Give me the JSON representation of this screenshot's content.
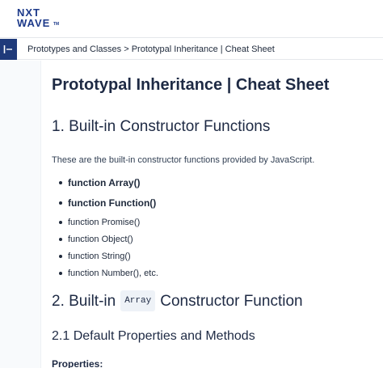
{
  "brand": {
    "line1": "NXT",
    "line2": "WAVE",
    "tm": "TM",
    "color": "#1d3a8a"
  },
  "sidebar_toggle": {
    "icon": "collapse-sidebar-icon",
    "color": "#1f3a7a"
  },
  "breadcrumb": "Prototypes and Classes > Prototypal Inheritance | Cheat Sheet",
  "page_title": "Prototypal Inheritance | Cheat Sheet",
  "section1": {
    "heading": "1. Built-in Constructor Functions",
    "intro": "These are the built-in constructor functions provided by JavaScript.",
    "items": [
      "function Array()",
      "function Function()",
      "function Promise()",
      "function Object()",
      "function String()",
      "function Number(), etc."
    ]
  },
  "section2": {
    "heading_prefix": "2. Built-in",
    "heading_code": "Array",
    "heading_suffix": "Constructor Function",
    "sub_heading": "2.1 Default Properties and Methods",
    "properties_label": "Properties:"
  }
}
